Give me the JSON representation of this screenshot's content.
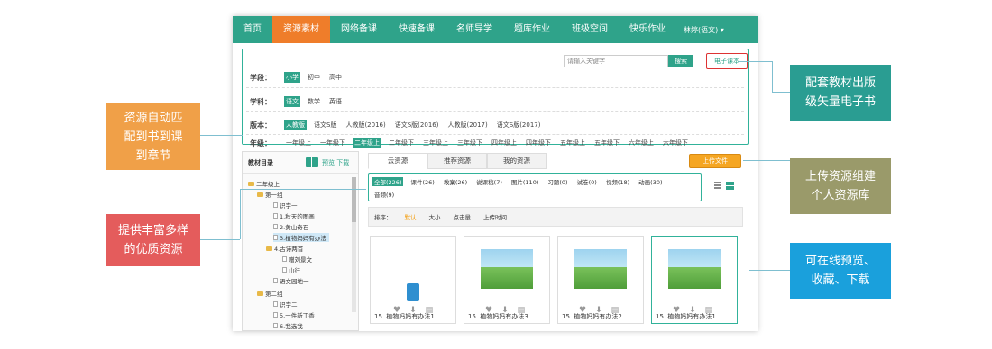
{
  "nav": {
    "items": [
      "首页",
      "资源素材",
      "网络备课",
      "快速备课",
      "名师导学",
      "题库作业",
      "班级空间",
      "快乐作业"
    ],
    "active_index": 1,
    "user": "林婷(语文) ▾"
  },
  "filters": {
    "stage": {
      "label": "学段：",
      "options": [
        "小学",
        "初中",
        "高中"
      ],
      "selected": 0
    },
    "subject": {
      "label": "学科：",
      "options": [
        "语文",
        "数学",
        "英语"
      ],
      "selected": 0
    },
    "edition": {
      "label": "版本：",
      "options": [
        "人教版",
        "语文S版",
        "人教版(2016)",
        "语文S版(2016)",
        "人教版(2017)",
        "语文S版(2017)"
      ],
      "selected": 0
    },
    "grade": {
      "label": "年级：",
      "options": [
        "一年级上",
        "一年级下",
        "二年级上",
        "二年级下",
        "三年级上",
        "三年级下",
        "四年级上",
        "四年级下",
        "五年级上",
        "五年级下",
        "六年级上",
        "六年级下"
      ],
      "selected": 2
    },
    "search_placeholder": "请输入关键字",
    "search_button": "搜索",
    "ebook_button": "电子课本"
  },
  "tree": {
    "title": "教材目录",
    "actions": "预览 下载",
    "items": [
      "二年级上",
      "第一组",
      "识字一",
      "1.秋天的图画",
      "2.黄山奇石",
      "3.植物妈妈有办法",
      "4.古诗两首",
      "赠刘景文",
      "山行",
      "语文园地一",
      "第二组",
      "识字二",
      "5.一件新丁香",
      "6.我选我"
    ]
  },
  "tabs": [
    "云资源",
    "推荐资源",
    "我的资源"
  ],
  "upload_button": "上传文件",
  "types": {
    "row1": [
      "全部(226)",
      "课件(26)",
      "教案(26)",
      "说课稿(7)",
      "图片(110)",
      "习题(0)",
      "试卷(0)",
      "视频(18)",
      "动画(30)"
    ],
    "row2": [
      "音频(9)"
    ]
  },
  "sort": {
    "label": "排序：",
    "options": [
      "默认",
      "大小",
      "点击量",
      "上传时间"
    ],
    "selected": 0
  },
  "cards": [
    {
      "title": "15. 植物妈妈有办法1",
      "thumb": "audio"
    },
    {
      "title": "15. 植物妈妈有办法3",
      "thumb": "scene"
    },
    {
      "title": "15. 植物妈妈有办法2",
      "thumb": "scene"
    },
    {
      "title": "15. 植物妈妈有办法1",
      "thumb": "scene"
    }
  ],
  "callouts": {
    "left1": "资源自动匹\n配到书到课\n到章节",
    "left2": "提供丰富多样\n的优质资源",
    "right1": "配套教材出版\n级矢量电子书",
    "right2": "上传资源组建\n个人资源库",
    "right3": "可在线预览、\n收藏、下载"
  },
  "colors": {
    "primary": "#2fa38a",
    "accent": "#ef7d2a",
    "callout_orange": "#f0a048",
    "callout_red": "#e45c5c",
    "callout_teal": "#2a9d92",
    "callout_olive": "#9a9a6a",
    "callout_blue": "#1aa0dc"
  }
}
